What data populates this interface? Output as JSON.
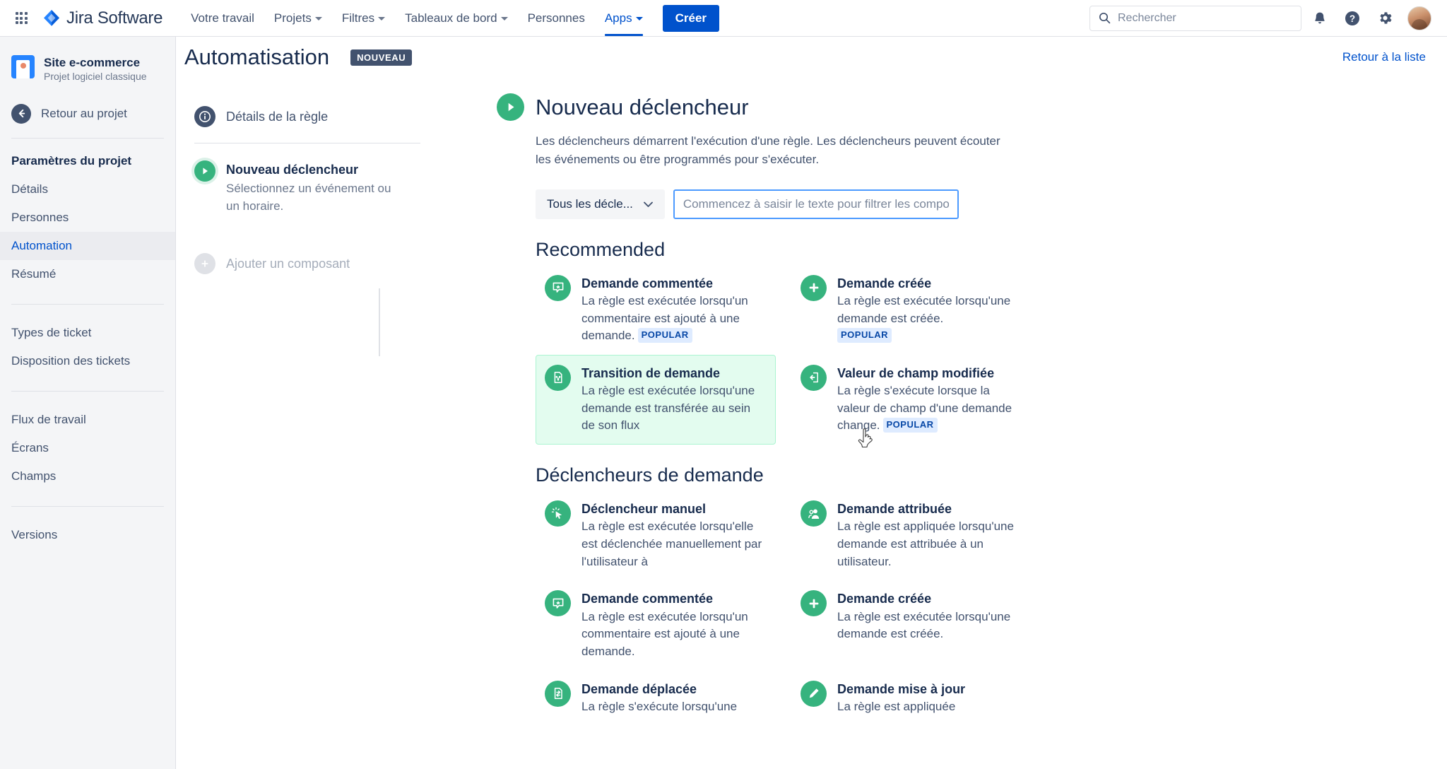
{
  "topnav": {
    "apps_label": "app-switcher",
    "brand": "Jira Software",
    "items": [
      {
        "label": "Votre travail",
        "has_caret": false,
        "active": false
      },
      {
        "label": "Projets",
        "has_caret": true,
        "active": false
      },
      {
        "label": "Filtres",
        "has_caret": true,
        "active": false
      },
      {
        "label": "Tableaux de bord",
        "has_caret": true,
        "active": false
      },
      {
        "label": "Personnes",
        "has_caret": false,
        "active": false
      },
      {
        "label": "Apps",
        "has_caret": true,
        "active": true
      }
    ],
    "create_label": "Créer",
    "search_placeholder": "Rechercher",
    "search_value": ""
  },
  "sidebar": {
    "project_name": "Site e-commerce",
    "project_type": "Projet logiciel classique",
    "back_label": "Retour au projet",
    "section_title": "Paramètres du projet",
    "group1": [
      {
        "label": "Détails",
        "active": false
      },
      {
        "label": "Personnes",
        "active": false
      },
      {
        "label": "Automation",
        "active": true
      },
      {
        "label": "Résumé",
        "active": false
      }
    ],
    "group2": [
      {
        "label": "Types de ticket",
        "active": false
      },
      {
        "label": "Disposition des tickets",
        "active": false
      }
    ],
    "group3": [
      {
        "label": "Flux de travail",
        "active": false
      },
      {
        "label": "Écrans",
        "active": false
      },
      {
        "label": "Champs",
        "active": false
      }
    ],
    "group4": [
      {
        "label": "Versions",
        "active": false
      }
    ]
  },
  "page_header": {
    "title": "Automatisation",
    "badge": "NOUVEAU",
    "back_to_list": "Retour à la liste"
  },
  "rule_panel": {
    "details_label": "Détails de la règle",
    "trigger_title": "Nouveau déclencheur",
    "trigger_sub": "Sélectionnez un événement ou un horaire.",
    "add_component_label": "Ajouter un composant"
  },
  "main": {
    "title": "Nouveau déclencheur",
    "description": "Les déclencheurs démarrent l'exécution d'une règle. Les déclencheurs peuvent écouter les événements ou être programmés pour s'exécuter.",
    "filter_select_value": "Tous les décle...",
    "filter_input_placeholder": "Commencez à saisir le texte pour filtrer les composa",
    "filter_input_value": "",
    "sections": [
      {
        "heading": "Recommended",
        "cards": [
          {
            "title": "Demande commentée",
            "desc": "La règle est exécutée lorsqu'un commentaire est ajouté à une demande.",
            "badge": "POPULAR",
            "icon": "comment-icon",
            "selected": false
          },
          {
            "title": "Demande créée",
            "desc": "La règle est exécutée lorsqu'une demande est créée.",
            "badge": "POPULAR",
            "icon": "plus-icon",
            "selected": false
          },
          {
            "title": "Transition de demande",
            "desc": "La règle est exécutée lorsqu'une demande est transférée au sein de son flux",
            "badge": "",
            "icon": "transition-icon",
            "selected": true
          },
          {
            "title": "Valeur de champ modifiée",
            "desc": "La règle s'exécute lorsque la valeur de champ d'une demande change.",
            "badge": "POPULAR",
            "icon": "field-change-icon",
            "selected": false
          }
        ]
      },
      {
        "heading": "Déclencheurs de demande",
        "cards": [
          {
            "title": "Déclencheur manuel",
            "desc": "La règle est exécutée lorsqu'elle est déclenchée manuellement par l'utilisateur à",
            "badge": "",
            "icon": "manual-click-icon",
            "selected": false
          },
          {
            "title": "Demande attribuée",
            "desc": "La règle est appliquée lorsqu'une demande est attribuée à un utilisateur.",
            "badge": "",
            "icon": "assignee-icon",
            "selected": false
          },
          {
            "title": "Demande commentée",
            "desc": "La règle est exécutée lorsqu'un commentaire est ajouté à une demande.",
            "badge": "",
            "icon": "comment-icon",
            "selected": false
          },
          {
            "title": "Demande créée",
            "desc": "La règle est exécutée lorsqu'une demande est créée.",
            "badge": "",
            "icon": "plus-icon",
            "selected": false
          },
          {
            "title": "Demande déplacée",
            "desc": "La règle s'exécute lorsqu'une",
            "badge": "",
            "icon": "move-icon",
            "selected": false
          },
          {
            "title": "Demande mise à jour",
            "desc": "La règle est appliquée",
            "badge": "",
            "icon": "pencil-icon",
            "selected": false
          }
        ]
      }
    ]
  },
  "colors": {
    "brand_blue": "#0052cc",
    "green": "#36b37e",
    "selected_card_bg": "#e3fcef",
    "selected_card_border": "#abf5d1",
    "badge_bg": "#deebff",
    "badge_text": "#0747a6",
    "sidebar_bg": "#f4f5f7"
  }
}
